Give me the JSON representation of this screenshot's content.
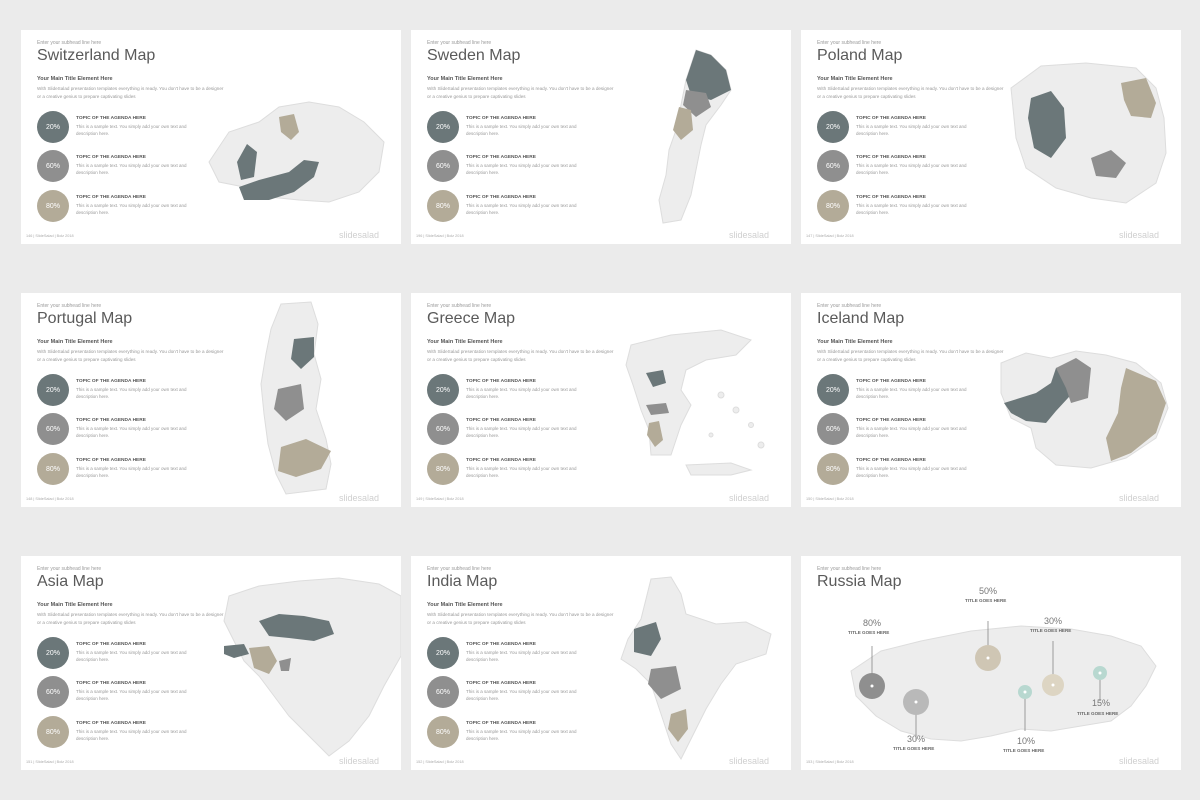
{
  "slides": [
    {
      "subhead": "Enter your subhead line here",
      "title": "Switzerland Map",
      "main_title": "Your Main Title Element Here",
      "desc": "With SlideSalad presentation templates everything is ready. You don't have to be a designer or a creative genius to prepare captivating slides",
      "items": [
        {
          "pct": "20%",
          "title": "TOPIC OF THE AGENDA HERE",
          "text": "This is a sample text. You simply add your own text and description here."
        },
        {
          "pct": "60%",
          "title": "TOPIC OF THE AGENDA HERE",
          "text": "This is a sample text. You simply add your own text and description here."
        },
        {
          "pct": "80%",
          "title": "TOPIC OF THE AGENDA HERE",
          "text": "This is a sample text. You simply add your own text and description here."
        }
      ],
      "footer": "146 | SlideSalad | Bolz 2018",
      "brand": "slidesalad"
    },
    {
      "subhead": "Enter your subhead line here",
      "title": "Sweden Map",
      "main_title": "Your Main Title Element Here",
      "desc": "With SlideSalad presentation templates everything is ready. You don't have to be a designer or a creative genius to prepare captivating slides",
      "items": [
        {
          "pct": "20%",
          "title": "TOPIC OF THE AGENDA HERE",
          "text": "This is a sample text. You simply add your own text and description here."
        },
        {
          "pct": "60%",
          "title": "TOPIC OF THE AGENDA HERE",
          "text": "This is a sample text. You simply add your own text and description here."
        },
        {
          "pct": "80%",
          "title": "TOPIC OF THE AGENDA HERE",
          "text": "This is a sample text. You simply add your own text and description here."
        }
      ],
      "footer": "196 | SlideSalad | Bolz 2018",
      "brand": "slidesalad"
    },
    {
      "subhead": "Enter your subhead line here",
      "title": "Poland Map",
      "main_title": "Your Main Title Element Here",
      "desc": "With SlideSalad presentation templates everything is ready. You don't have to be a designer or a creative genius to prepare captivating slides",
      "items": [
        {
          "pct": "20%",
          "title": "TOPIC OF THE AGENDA HERE",
          "text": "This is a sample text. You simply add your own text and description here."
        },
        {
          "pct": "60%",
          "title": "TOPIC OF THE AGENDA HERE",
          "text": "This is a sample text. You simply add your own text and description here."
        },
        {
          "pct": "80%",
          "title": "TOPIC OF THE AGENDA HERE",
          "text": "This is a sample text. You simply add your own text and description here."
        }
      ],
      "footer": "147 | SlideSalad | Bolz 2018",
      "brand": "slidesalad"
    },
    {
      "subhead": "Enter your subhead line here",
      "title": "Portugal Map",
      "main_title": "Your Main Title Element Here",
      "desc": "With SlideSalad presentation templates everything is ready. You don't have to be a designer or a creative genius to prepare captivating slides",
      "items": [
        {
          "pct": "20%",
          "title": "TOPIC OF THE AGENDA HERE",
          "text": "This is a sample text. You simply add your own text and description here."
        },
        {
          "pct": "60%",
          "title": "TOPIC OF THE AGENDA HERE",
          "text": "This is a sample text. You simply add your own text and description here."
        },
        {
          "pct": "80%",
          "title": "TOPIC OF THE AGENDA HERE",
          "text": "This is a sample text. You simply add your own text and description here."
        }
      ],
      "footer": "148 | SlideSalad | Bolz 2018",
      "brand": "slidesalad"
    },
    {
      "subhead": "Enter your subhead line here",
      "title": "Greece Map",
      "main_title": "Your Main Title Element Here",
      "desc": "With SlideSalad presentation templates everything is ready. You don't have to be a designer or a creative genius to prepare captivating slides",
      "items": [
        {
          "pct": "20%",
          "title": "TOPIC OF THE AGENDA HERE",
          "text": "This is a sample text. You simply add your own text and description here."
        },
        {
          "pct": "60%",
          "title": "TOPIC OF THE AGENDA HERE",
          "text": "This is a sample text. You simply add your own text and description here."
        },
        {
          "pct": "80%",
          "title": "TOPIC OF THE AGENDA HERE",
          "text": "This is a sample text. You simply add your own text and description here."
        }
      ],
      "footer": "149 | SlideSalad | Bolz 2018",
      "brand": "slidesalad"
    },
    {
      "subhead": "Enter your subhead line here",
      "title": "Iceland Map",
      "main_title": "Your Main Title Element Here",
      "desc": "With SlideSalad presentation templates everything is ready. You don't have to be a designer or a creative genius to prepare captivating slides",
      "items": [
        {
          "pct": "20%",
          "title": "TOPIC OF THE AGENDA HERE",
          "text": "This is a sample text. You simply add your own text and description here."
        },
        {
          "pct": "60%",
          "title": "TOPIC OF THE AGENDA HERE",
          "text": "This is a sample text. You simply add your own text and description here."
        },
        {
          "pct": "80%",
          "title": "TOPIC OF THE AGENDA HERE",
          "text": "This is a sample text. You simply add your own text and description here."
        }
      ],
      "footer": "150 | SlideSalad | Bolz 2018",
      "brand": "slidesalad"
    },
    {
      "subhead": "Enter your subhead line here",
      "title": "Asia Map",
      "main_title": "Your Main Title Element Here",
      "desc": "With SlideSalad presentation templates everything is ready. You don't have to be a designer or a creative genius to prepare captivating slides",
      "items": [
        {
          "pct": "20%",
          "title": "TOPIC OF THE AGENDA HERE",
          "text": "This is a sample text. You simply add your own text and description here."
        },
        {
          "pct": "60%",
          "title": "TOPIC OF THE AGENDA HERE",
          "text": "This is a sample text. You simply add your own text and description here."
        },
        {
          "pct": "80%",
          "title": "TOPIC OF THE AGENDA HERE",
          "text": "This is a sample text. You simply add your own text and description here."
        }
      ],
      "footer": "151 | SlideSalad | Bolz 2018",
      "brand": "slidesalad"
    },
    {
      "subhead": "Enter your subhead line here",
      "title": "India Map",
      "main_title": "Your Main Title Element Here",
      "desc": "With SlideSalad presentation templates everything is ready. You don't have to be a designer or a creative genius to prepare captivating slides",
      "items": [
        {
          "pct": "20%",
          "title": "TOPIC OF THE AGENDA HERE",
          "text": "This is a sample text. You simply add your own text and description here."
        },
        {
          "pct": "60%",
          "title": "TOPIC OF THE AGENDA HERE",
          "text": "This is a sample text. You simply add your own text and description here."
        },
        {
          "pct": "80%",
          "title": "TOPIC OF THE AGENDA HERE",
          "text": "This is a sample text. You simply add your own text and description here."
        }
      ],
      "footer": "152 | SlideSalad | Bolz 2018",
      "brand": "slidesalad"
    },
    {
      "subhead": "Enter your subhead line here",
      "title": "Russia Map",
      "callouts": [
        {
          "pct": "80%",
          "label": "TITLE GOES HERE"
        },
        {
          "pct": "30%",
          "label": "TITLE GOES HERE"
        },
        {
          "pct": "50%",
          "label": "TITLE GOES HERE"
        },
        {
          "pct": "10%",
          "label": "TITLE GOES HERE"
        },
        {
          "pct": "30%",
          "label": "TITLE GOES HERE"
        },
        {
          "pct": "15%",
          "label": "TITLE GOES HERE"
        }
      ],
      "footer": "153 | SlideSalad | Bolz 2018",
      "brand": "slidesalad"
    }
  ],
  "colors": {
    "dark": "#6b7779",
    "gray": "#8f8f8f",
    "tan": "#b3ab98",
    "map_base": "#ededed",
    "teal": "#b8d8d0",
    "background": "#ebebeb"
  }
}
